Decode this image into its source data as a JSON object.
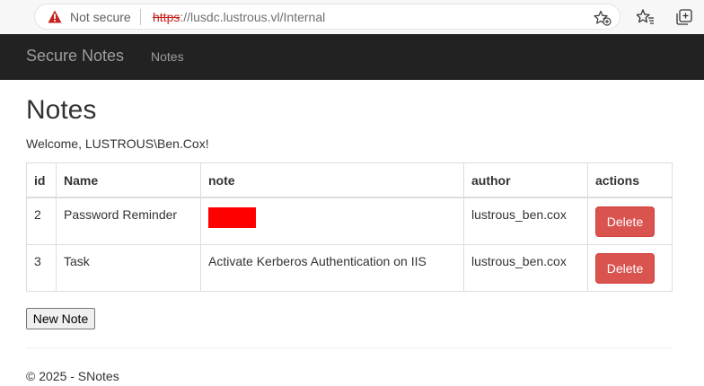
{
  "browser": {
    "security_label": "Not secure",
    "url_scheme": "https",
    "url_host": "://lusdc.lustrous.vl",
    "url_path": "/Internal"
  },
  "navbar": {
    "brand": "Secure Notes",
    "links": [
      "Notes"
    ]
  },
  "page": {
    "title": "Notes",
    "welcome": "Welcome, LUSTROUS\\Ben.Cox!"
  },
  "table": {
    "headers": [
      "id",
      "Name",
      "note",
      "author",
      "actions"
    ],
    "rows": [
      {
        "id": "2",
        "name": "Password Reminder",
        "note": "",
        "note_redacted": true,
        "author": "lustrous_ben.cox",
        "action": "Delete"
      },
      {
        "id": "3",
        "name": "Task",
        "note": "Activate Kerberos Authentication on IIS",
        "note_redacted": false,
        "author": "lustrous_ben.cox",
        "action": "Delete"
      }
    ]
  },
  "new_note_button": "New Note",
  "footer": "© 2025 - SNotes",
  "colors": {
    "navbar_bg": "#222222",
    "navbar_text": "#9d9d9d",
    "delete_button": "#d9534f",
    "redaction": "#ff0000",
    "insecure_scheme": "#c5221f"
  },
  "icons": {
    "security": "warning-triangle-icon",
    "favorite_add": "star-add-icon",
    "favorites": "favorites-icon",
    "collections": "collections-icon"
  }
}
